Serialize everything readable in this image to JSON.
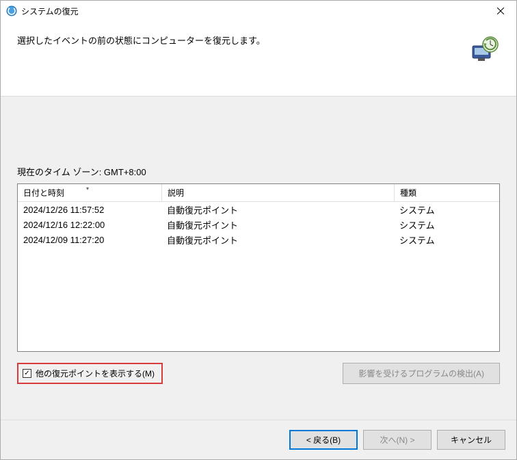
{
  "window": {
    "title": "システムの復元"
  },
  "header": {
    "message": "選択したイベントの前の状態にコンピューターを復元します。"
  },
  "content": {
    "timezone_label": "現在のタイム ゾーン: GMT+8:00",
    "columns": {
      "date": "日付と時刻",
      "desc": "説明",
      "type": "種類"
    },
    "rows": [
      {
        "date": "2024/12/26 11:57:52",
        "desc": "自動復元ポイント",
        "type": "システム"
      },
      {
        "date": "2024/12/16 12:22:00",
        "desc": "自動復元ポイント",
        "type": "システム"
      },
      {
        "date": "2024/12/09 11:27:20",
        "desc": "自動復元ポイント",
        "type": "システム"
      }
    ],
    "checkbox_label": "他の復元ポイントを表示する(M)",
    "checkbox_checked": true,
    "detect_button": "影響を受けるプログラムの検出(A)"
  },
  "footer": {
    "back": "< 戻る(B)",
    "next": "次へ(N) >",
    "cancel": "キャンセル"
  }
}
